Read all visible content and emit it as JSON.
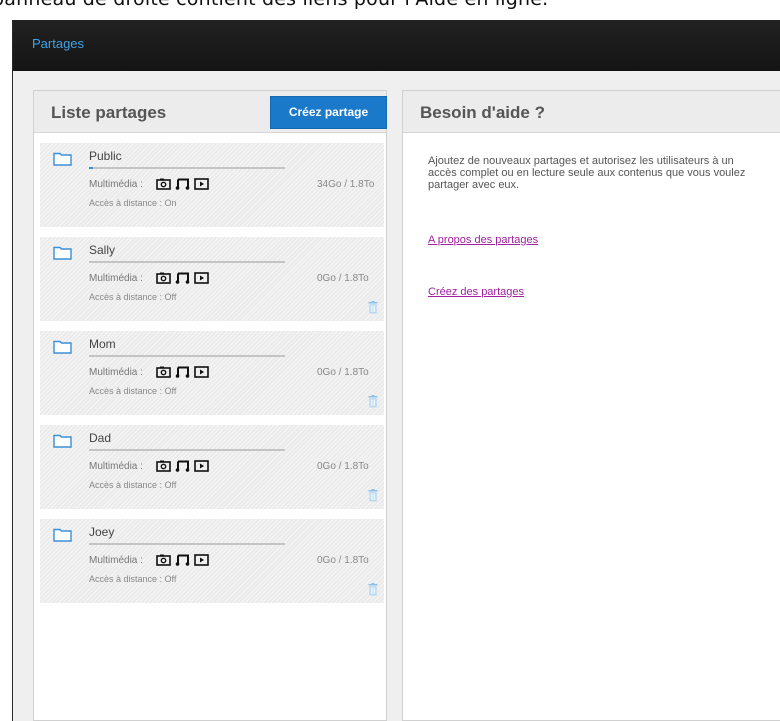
{
  "caption": "panneau de droite contient des liens pour l'Aide en ligne.",
  "topbar": {
    "breadcrumb": "Partages"
  },
  "left_panel": {
    "title": "Liste partages",
    "create_button": "Créez partage",
    "shares": [
      {
        "name": "Public",
        "media_label": "Multimédia :",
        "usage": "34Go / 1.8To",
        "remote": "Accès à distance : On",
        "used_fraction": 0.02,
        "deletable": false
      },
      {
        "name": "Sally",
        "media_label": "Multimédia :",
        "usage": "0Go / 1.8To",
        "remote": "Accès à distance : Off",
        "used_fraction": 0,
        "deletable": true
      },
      {
        "name": "Mom",
        "media_label": "Multimédia :",
        "usage": "0Go / 1.8To",
        "remote": "Accès à distance : Off",
        "used_fraction": 0,
        "deletable": true
      },
      {
        "name": "Dad",
        "media_label": "Multimédia :",
        "usage": "0Go / 1.8To",
        "remote": "Accès à distance : Off",
        "used_fraction": 0,
        "deletable": true
      },
      {
        "name": "Joey",
        "media_label": "Multimédia :",
        "usage": "0Go / 1.8To",
        "remote": "Accès à distance : Off",
        "used_fraction": 0,
        "deletable": true
      }
    ],
    "media_icons": [
      "photo-icon",
      "music-icon",
      "video-icon"
    ]
  },
  "right_panel": {
    "title": "Besoin d'aide ?",
    "description": "Ajoutez de nouveaux partages et autorisez les utilisateurs à un accès complet ou en lecture seule aux contenus que vous voulez partager avec eux.",
    "links": [
      "A propos des partages",
      "Créez des partages"
    ]
  },
  "colors": {
    "accent": "#1a79c9",
    "link": "#a020a0",
    "topbar": "#1a1a1a",
    "breadcrumb": "#3ea3e8"
  }
}
